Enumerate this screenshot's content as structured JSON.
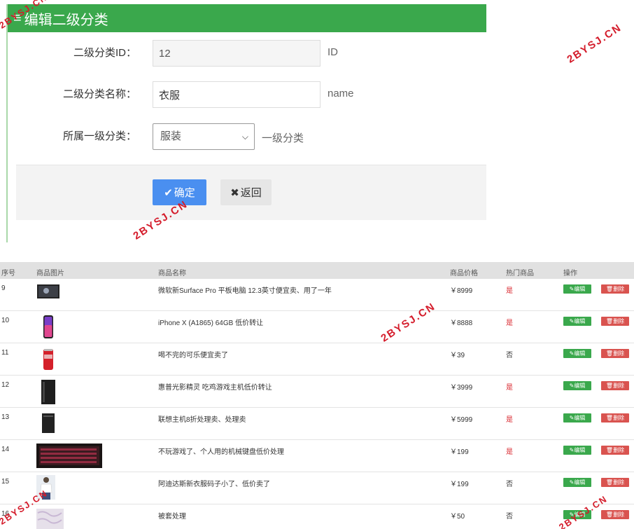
{
  "panel": {
    "title": "编辑二级分类",
    "fields": {
      "id": {
        "label": "二级分类ID：",
        "value": "12",
        "hint": "ID"
      },
      "name": {
        "label": "二级分类名称：",
        "value": "衣服",
        "hint": "name"
      },
      "parent": {
        "label": "所属一级分类：",
        "selected": "服装",
        "hint": "一级分类"
      }
    },
    "buttons": {
      "ok": "确定",
      "back": "返回"
    }
  },
  "table": {
    "headers": [
      "序号",
      "商品图片",
      "商品名称",
      "商品价格",
      "热门商品",
      "操作"
    ],
    "edit_label": "编辑",
    "delete_label": "删除",
    "rows": [
      {
        "no": "9",
        "name": "微软新Surface Pro 平板电脑 12.3英寸便宜卖、用了一年",
        "price": "￥8999",
        "hot": "是"
      },
      {
        "no": "10",
        "name": "iPhone X (A1865) 64GB 低价转让",
        "price": "￥8888",
        "hot": "是"
      },
      {
        "no": "11",
        "name": "喝不完的可乐便宜卖了",
        "price": "￥39",
        "hot": "否"
      },
      {
        "no": "12",
        "name": "惠普光影精灵 吃鸡游戏主机低价转让",
        "price": "￥3999",
        "hot": "是"
      },
      {
        "no": "13",
        "name": "联想主机8折处理卖、处理卖",
        "price": "￥5999",
        "hot": "是"
      },
      {
        "no": "14",
        "name": "不玩游戏了、个人用的机械键盘低价处理",
        "price": "￥199",
        "hot": "是"
      },
      {
        "no": "15",
        "name": "阿迪达斯新衣服码子小了、低价卖了",
        "price": "￥199",
        "hot": "否"
      },
      {
        "no": "16",
        "name": "被套处理",
        "price": "￥50",
        "hot": "否"
      }
    ]
  },
  "watermark": "2BYSJ.CN",
  "colors": {
    "header_green": "#3aa84c",
    "primary_blue": "#4a8ff0",
    "danger_red": "#d9534f",
    "hot_red": "#d9262d"
  }
}
